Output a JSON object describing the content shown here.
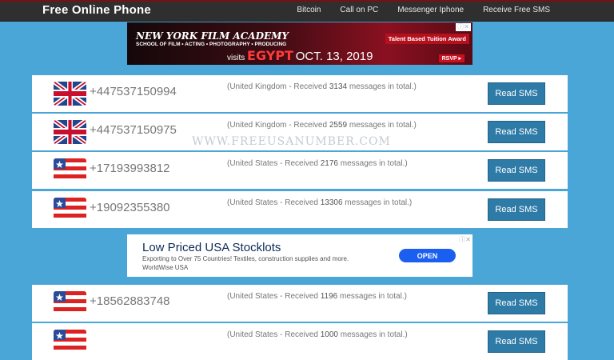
{
  "header": {
    "brand": "Free Online Phone",
    "nav": [
      "Bitcoin",
      "Call on PC",
      "Messenger Iphone",
      "Receive Free SMS"
    ]
  },
  "banner_ad": {
    "line1": "NEW YORK FILM ACADEMY",
    "line2": "SCHOOL OF FILM • ACTING • PHOTOGRAPHY • PRODUCING",
    "visits": "visits",
    "country": "EGYPT",
    "date": "OCT. 13, 2019",
    "badge": "Talent Based Tuition Award",
    "rsvp": "RSVP ▸",
    "close": "ⓘ✕"
  },
  "watermark": "WWW.FREEUSANUMBER.COM",
  "numbers": [
    {
      "flag": "uk-flag-icon",
      "phone": "+447537150994",
      "pre": "(United Kingdom - Received ",
      "count": "3134",
      "post": " messages in total.)",
      "button": "Read SMS"
    },
    {
      "flag": "uk-flag-icon",
      "phone": "+447537150975",
      "pre": "(United Kingdom - Received ",
      "count": "2559",
      "post": " messages in total.)",
      "button": "Read SMS"
    },
    {
      "flag": "us-flag-icon",
      "phone": "+17193993812",
      "pre": "(United States - Received ",
      "count": "2176",
      "post": " messages in total.)",
      "button": "Read SMS"
    },
    {
      "flag": "us-flag-icon",
      "phone": "+19092355380",
      "pre": "(United States - Received ",
      "count": "13306",
      "post": " messages in total.)",
      "button": "Read SMS"
    },
    {
      "flag": "us-flag-icon",
      "phone": "+18562883748",
      "pre": "(United States - Received ",
      "count": "1196",
      "post": " messages in total.)",
      "button": "Read SMS"
    },
    {
      "flag": "us-flag-icon",
      "phone": "",
      "pre": "(United States - Received ",
      "count": "1000",
      "post": " messages in total.)",
      "button": "Read SMS"
    }
  ],
  "ad2": {
    "title": "Low Priced USA Stocklots",
    "desc": "Exporting to Over 75 Countries! Textiles, construction supplies and more.",
    "sponsor": "WorldWise USA",
    "cta": "OPEN",
    "close": "ⓘ✕"
  },
  "colors": {
    "background": "#4aa6d6",
    "button": "#2e7ba7",
    "topbar": "#2f2f2f"
  }
}
